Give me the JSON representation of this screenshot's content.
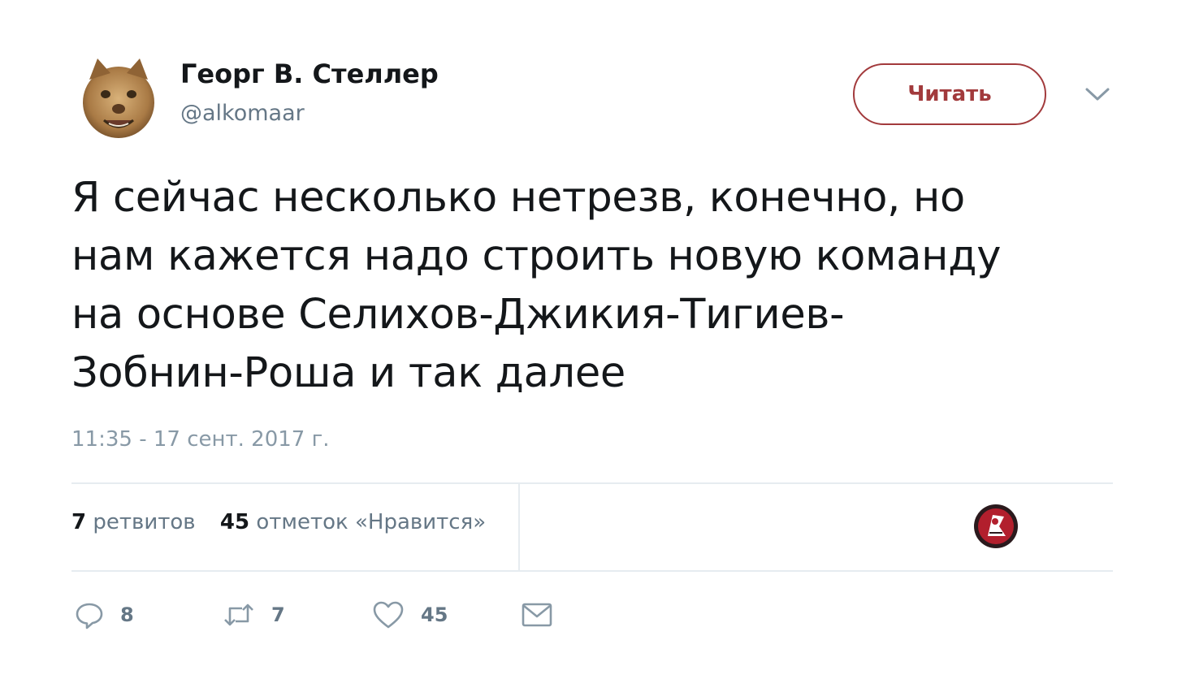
{
  "author": {
    "name": "Георг В. Стеллер",
    "handle": "@alkomaar",
    "avatar_icon": "cat-face-avatar"
  },
  "follow_button": {
    "label": "Читать",
    "color": "#a23a3c"
  },
  "menu_icon": "chevron-down-icon",
  "tweet": {
    "lines": [
      "Я сейчас несколько нетрезв, конечно, но",
      "нам кажется надо строить новую команду",
      "на основе Селихов-Джикия-Тигиев-",
      "Зобнин-Роша и так далее"
    ],
    "timestamp": "11:35 - 17 сент. 2017 г."
  },
  "stats": {
    "retweets_count": "7",
    "retweets_label": "ретвитов",
    "likes_count": "45",
    "likes_label": "отметок «Нравится»"
  },
  "liker_avatar_icon": "spartak-logo-avatar",
  "actions": {
    "reply": {
      "icon": "reply-icon",
      "count": "8"
    },
    "retweet": {
      "icon": "retweet-icon",
      "count": "7"
    },
    "like": {
      "icon": "heart-icon",
      "count": "45"
    },
    "message": {
      "icon": "mail-icon"
    }
  },
  "colors": {
    "text": "#14171a",
    "secondary": "#657786",
    "timestamp": "#8899a6",
    "divider": "#e6ecf0",
    "accent": "#a23a3c"
  }
}
